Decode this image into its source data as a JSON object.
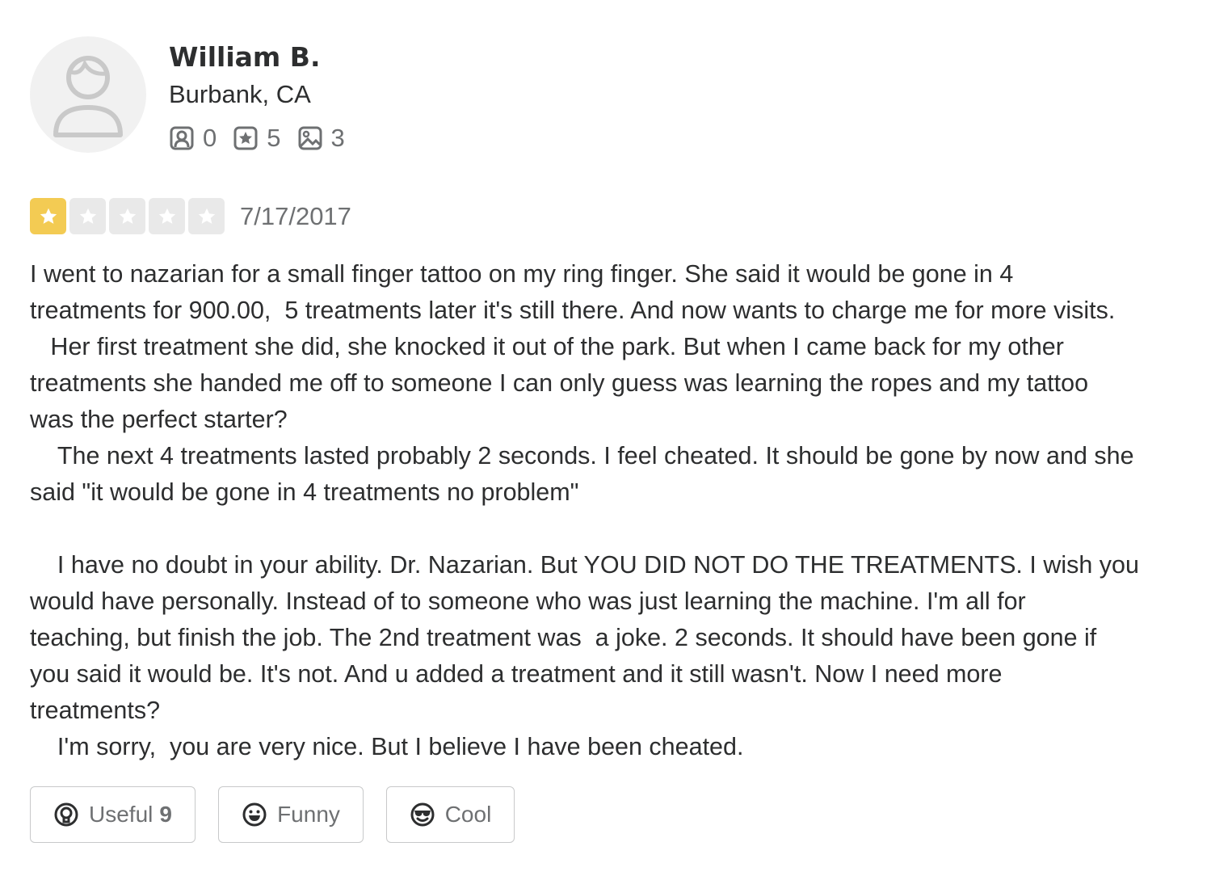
{
  "user": {
    "name": "William B.",
    "location": "Burbank, CA",
    "stats": {
      "friends": "0",
      "reviews": "5",
      "photos": "3"
    }
  },
  "review": {
    "rating": 1,
    "max_rating": 5,
    "date": "7/17/2017",
    "text": "I went to nazarian for a small finger tattoo on my ring finger. She said it would be gone in 4\ntreatments for 900.00,  5 treatments later it's still there. And now wants to charge me for more visits.\n   Her first treatment she did, she knocked it out of the park. But when I came back for my other\ntreatments she handed me off to someone I can only guess was learning the ropes and my tattoo\nwas the perfect starter?\n    The next 4 treatments lasted probably 2 seconds. I feel cheated. It should be gone by now and she\nsaid \"it would be gone in 4 treatments no problem\"\n\n    I have no doubt in your ability. Dr. Nazarian. But YOU DID NOT DO THE TREATMENTS. I wish you\nwould have personally. Instead of to someone who was just learning the machine. I'm all for\nteaching, but finish the job. The 2nd treatment was  a joke. 2 seconds. It should have been gone if\nyou said it would be. It's not. And u added a treatment and it still wasn't. Now I need more\ntreatments?\n    I'm sorry,  you are very nice. But I believe I have been cheated."
  },
  "actions": {
    "useful_label": "Useful",
    "useful_count": "9",
    "funny_label": "Funny",
    "cool_label": "Cool"
  },
  "colors": {
    "star_active": "#f3cb53",
    "star_inactive": "#e9e9e9",
    "text_primary": "#2d2e2f",
    "text_secondary": "#6e7072",
    "button_border": "#c8c9ca"
  },
  "icons": {
    "friends": "friends-icon",
    "reviews": "review-star-icon",
    "photos": "photo-icon",
    "useful": "lightbulb-icon",
    "funny": "smile-icon",
    "cool": "sunglasses-icon"
  }
}
